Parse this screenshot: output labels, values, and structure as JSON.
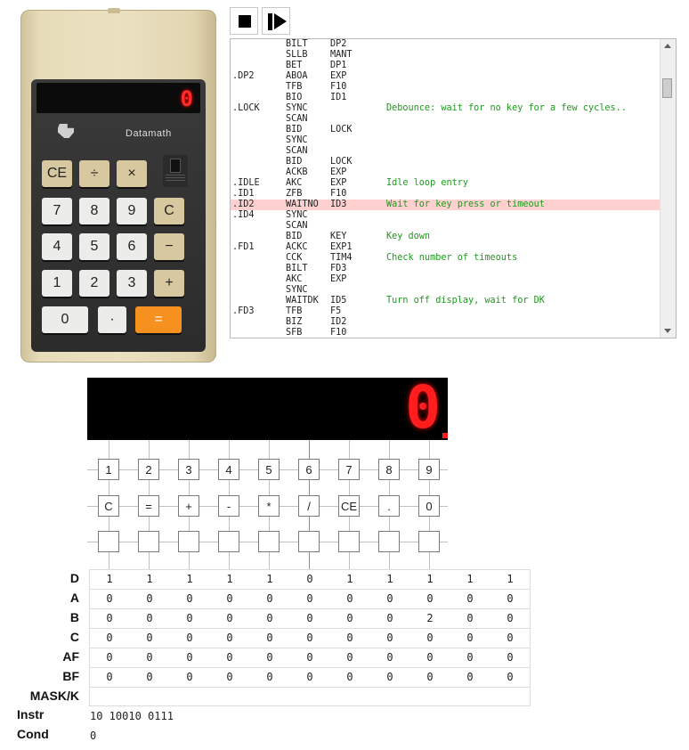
{
  "calculator": {
    "display": "0",
    "brand": "Datamath",
    "keys": [
      [
        "CE",
        "÷",
        "×"
      ],
      [
        "7",
        "8",
        "9",
        "C"
      ],
      [
        "4",
        "5",
        "6",
        "−"
      ],
      [
        "1",
        "2",
        "3",
        "+"
      ],
      [
        "0",
        "·",
        "="
      ]
    ]
  },
  "toolbar": {
    "stop_icon": "stop-icon",
    "step_icon": "step-icon"
  },
  "listing": [
    {
      "label": "",
      "op": "BILT",
      "arg": "DP2",
      "comment": ""
    },
    {
      "label": "",
      "op": "SLLB",
      "arg": "MANT",
      "comment": ""
    },
    {
      "label": "",
      "op": "BET",
      "arg": "DP1",
      "comment": ""
    },
    {
      "label": ".DP2",
      "op": "ABOA",
      "arg": "EXP",
      "comment": ""
    },
    {
      "label": "",
      "op": "TFB",
      "arg": "F10",
      "comment": ""
    },
    {
      "label": "",
      "op": "BIO",
      "arg": "ID1",
      "comment": ""
    },
    {
      "label": ".LOCK",
      "op": "SYNC",
      "arg": "",
      "comment": "Debounce: wait for no key for a few cycles.."
    },
    {
      "label": "",
      "op": "SCAN",
      "arg": "",
      "comment": ""
    },
    {
      "label": "",
      "op": "BID",
      "arg": "LOCK",
      "comment": ""
    },
    {
      "label": "",
      "op": "SYNC",
      "arg": "",
      "comment": ""
    },
    {
      "label": "",
      "op": "SCAN",
      "arg": "",
      "comment": ""
    },
    {
      "label": "",
      "op": "BID",
      "arg": "LOCK",
      "comment": ""
    },
    {
      "label": "",
      "op": "ACKB",
      "arg": "EXP",
      "comment": ""
    },
    {
      "label": ".IDLE",
      "op": "AKC",
      "arg": "EXP",
      "comment": "Idle loop entry"
    },
    {
      "label": ".ID1",
      "op": "ZFB",
      "arg": "F10",
      "comment": ""
    },
    {
      "label": ".ID2",
      "op": "WAITNO",
      "arg": "ID3",
      "comment": "Wait for key press or timeout",
      "highlight": true
    },
    {
      "label": ".ID4",
      "op": "SYNC",
      "arg": "",
      "comment": ""
    },
    {
      "label": "",
      "op": "SCAN",
      "arg": "",
      "comment": ""
    },
    {
      "label": "",
      "op": "BID",
      "arg": "KEY",
      "comment": "Key down"
    },
    {
      "label": ".FD1",
      "op": "ACKC",
      "arg": "EXP1",
      "comment": ""
    },
    {
      "label": "",
      "op": "CCK",
      "arg": "TIM4",
      "comment": "Check number of timeouts"
    },
    {
      "label": "",
      "op": "BILT",
      "arg": "FD3",
      "comment": ""
    },
    {
      "label": "",
      "op": "AKC",
      "arg": "EXP",
      "comment": ""
    },
    {
      "label": "",
      "op": "SYNC",
      "arg": "",
      "comment": ""
    },
    {
      "label": "",
      "op": "WAITDK",
      "arg": "ID5",
      "comment": "Turn off display, wait for DK"
    },
    {
      "label": ".FD3",
      "op": "TFB",
      "arg": "F5",
      "comment": ""
    },
    {
      "label": "",
      "op": "BIZ",
      "arg": "ID2",
      "comment": ""
    },
    {
      "label": "",
      "op": "SFB",
      "arg": "F10",
      "comment": ""
    }
  ],
  "display": {
    "digit": "0"
  },
  "matrix": {
    "rows": [
      [
        "1",
        "2",
        "3",
        "4",
        "5",
        "6",
        "7",
        "8",
        "9"
      ],
      [
        "C",
        "=",
        "+",
        "-",
        "*",
        "/",
        "CE",
        ".",
        "0"
      ],
      [
        "",
        "",
        "",
        "",
        "",
        "",
        "",
        "",
        ""
      ]
    ]
  },
  "registers": [
    {
      "name": "D",
      "values": [
        "1",
        "1",
        "1",
        "1",
        "1",
        "0",
        "1",
        "1",
        "1",
        "1",
        "1"
      ]
    },
    {
      "name": "A",
      "values": [
        "0",
        "0",
        "0",
        "0",
        "0",
        "0",
        "0",
        "0",
        "0",
        "0",
        "0"
      ]
    },
    {
      "name": "B",
      "values": [
        "0",
        "0",
        "0",
        "0",
        "0",
        "0",
        "0",
        "0",
        "2",
        "0",
        "0"
      ]
    },
    {
      "name": "C",
      "values": [
        "0",
        "0",
        "0",
        "0",
        "0",
        "0",
        "0",
        "0",
        "0",
        "0",
        "0"
      ]
    },
    {
      "name": "AF",
      "values": [
        "0",
        "0",
        "0",
        "0",
        "0",
        "0",
        "0",
        "0",
        "0",
        "0",
        "0"
      ]
    },
    {
      "name": "BF",
      "values": [
        "0",
        "0",
        "0",
        "0",
        "0",
        "0",
        "0",
        "0",
        "0",
        "0",
        "0"
      ]
    },
    {
      "name": "MASK/K",
      "values": []
    }
  ],
  "instr": {
    "label": "Instr",
    "value": "10 10010 0111"
  },
  "cond": {
    "label": "Cond",
    "value": "0"
  }
}
